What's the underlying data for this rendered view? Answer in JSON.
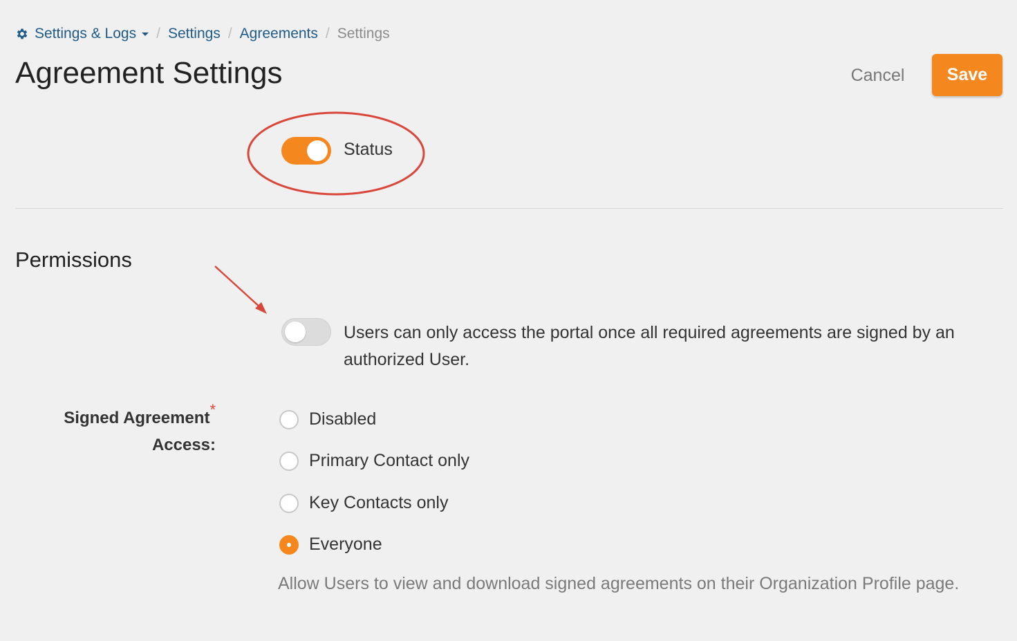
{
  "breadcrumb": {
    "root": "Settings & Logs",
    "items": [
      "Settings",
      "Agreements"
    ],
    "current": "Settings"
  },
  "page_title": "Agreement Settings",
  "actions": {
    "cancel": "Cancel",
    "save": "Save"
  },
  "status": {
    "label": "Status",
    "enabled": true
  },
  "permissions": {
    "title": "Permissions",
    "portal_access_text": "Users can only access the portal once all required agreements are signed by an authorized User.",
    "portal_access_enabled": false,
    "signed_access": {
      "label_line1": "Signed Agreement",
      "label_line2": "Access:",
      "required_mark": "*",
      "options": [
        "Disabled",
        "Primary Contact only",
        "Key Contacts only",
        "Everyone"
      ],
      "selected": "Everyone",
      "help": "Allow Users to view and download signed agreements on their Organization Profile page."
    }
  },
  "colors": {
    "accent": "#f5871f",
    "link": "#1f5a88",
    "annotation": "#d9473b"
  },
  "icons": {
    "breadcrumb_root": "gear-icon"
  }
}
